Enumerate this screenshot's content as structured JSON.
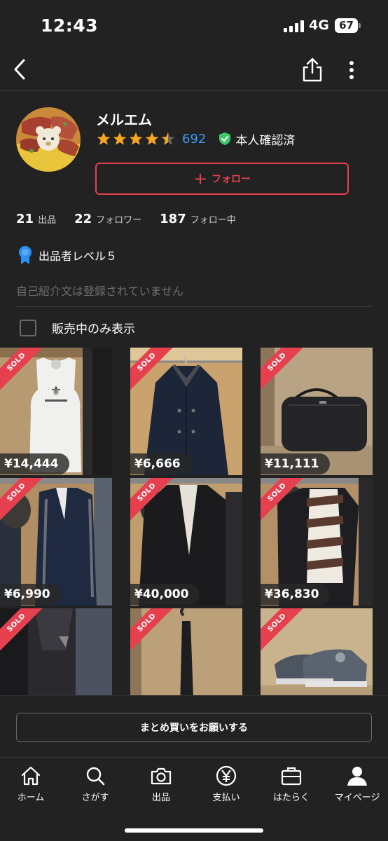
{
  "status_bar": {
    "time": "12:43",
    "network": "4G",
    "battery": "67"
  },
  "header": {
    "back_icon": "chevron-left-icon",
    "share_icon": "share-icon",
    "more_icon": "vertical-ellipsis-icon"
  },
  "profile": {
    "name": "メルエム",
    "rating_stars": 4.5,
    "review_count": "692",
    "verified_label": "本人確認済",
    "follow_label": "フォロー",
    "follow_plus": "+",
    "stats": {
      "listings_count": "21",
      "listings_label": "出品",
      "followers_count": "22",
      "followers_label": "フォロワー",
      "following_count": "187",
      "following_label": "フォロー中"
    },
    "seller_level": "出品者レベル５",
    "bio_placeholder": "自己紹介文は登録されていません",
    "filter_label": "販売中のみ表示"
  },
  "items": [
    {
      "sold": "SOLD",
      "price": "¥14,444"
    },
    {
      "sold": "SOLD",
      "price": "¥6,666"
    },
    {
      "sold": "SOLD",
      "price": "¥11,111"
    },
    {
      "sold": "SOLD",
      "price": "¥6,990"
    },
    {
      "sold": "SOLD",
      "price": "¥40,000"
    },
    {
      "sold": "SOLD",
      "price": "¥36,830"
    },
    {
      "sold": "SOLD",
      "price": ""
    },
    {
      "sold": "SOLD",
      "price": ""
    },
    {
      "sold": "SOLD",
      "price": ""
    }
  ],
  "bundle_button": "まとめ買いをお願いする",
  "tab_bar": {
    "tabs": [
      {
        "label": "ホーム",
        "icon": "home-icon"
      },
      {
        "label": "さがす",
        "icon": "search-icon"
      },
      {
        "label": "出品",
        "icon": "camera-icon"
      },
      {
        "label": "支払い",
        "icon": "yen-icon"
      },
      {
        "label": "はたらく",
        "icon": "briefcase-icon"
      },
      {
        "label": "マイページ",
        "icon": "person-icon"
      }
    ]
  },
  "colors": {
    "accent": "#e6404f",
    "link": "#3b9cf5",
    "star": "#f5a623",
    "verified": "#3dc86b",
    "background": "#222222"
  }
}
